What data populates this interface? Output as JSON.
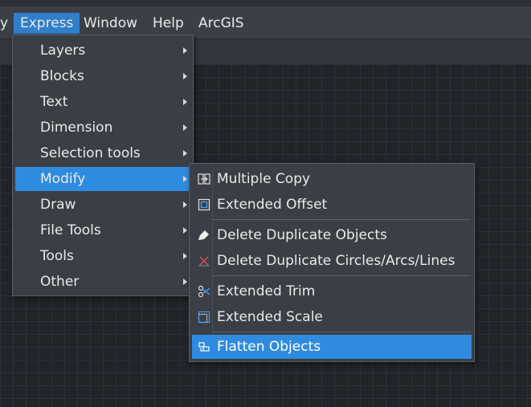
{
  "menubar": {
    "items": [
      {
        "label": "y"
      },
      {
        "label": "Express"
      },
      {
        "label": "Window"
      },
      {
        "label": "Help"
      },
      {
        "label": "ArcGIS"
      }
    ]
  },
  "express_menu": {
    "items": [
      {
        "label": "Layers"
      },
      {
        "label": "Blocks"
      },
      {
        "label": "Text"
      },
      {
        "label": "Dimension"
      },
      {
        "label": "Selection tools"
      },
      {
        "label": "Modify"
      },
      {
        "label": "Draw"
      },
      {
        "label": "File Tools"
      },
      {
        "label": "Tools"
      },
      {
        "label": "Other"
      }
    ]
  },
  "modify_submenu": {
    "items": [
      {
        "label": "Multiple Copy",
        "icon": "multiple-copy-icon"
      },
      {
        "label": "Extended Offset",
        "icon": "extended-offset-icon"
      },
      {
        "label": "Delete Duplicate Objects",
        "icon": "delete-duplicate-objects-icon"
      },
      {
        "label": "Delete Duplicate Circles/Arcs/Lines",
        "icon": "delete-duplicate-circles-icon"
      },
      {
        "label": "Extended Trim",
        "icon": "extended-trim-icon"
      },
      {
        "label": "Extended Scale",
        "icon": "extended-scale-icon"
      },
      {
        "label": "Flatten Objects",
        "icon": "flatten-objects-icon"
      }
    ]
  },
  "colors": {
    "highlight": "#2f8be0",
    "menubar_active": "#2f7fca",
    "menu_bg": "#3a3f46",
    "canvas_bg": "#212429"
  }
}
